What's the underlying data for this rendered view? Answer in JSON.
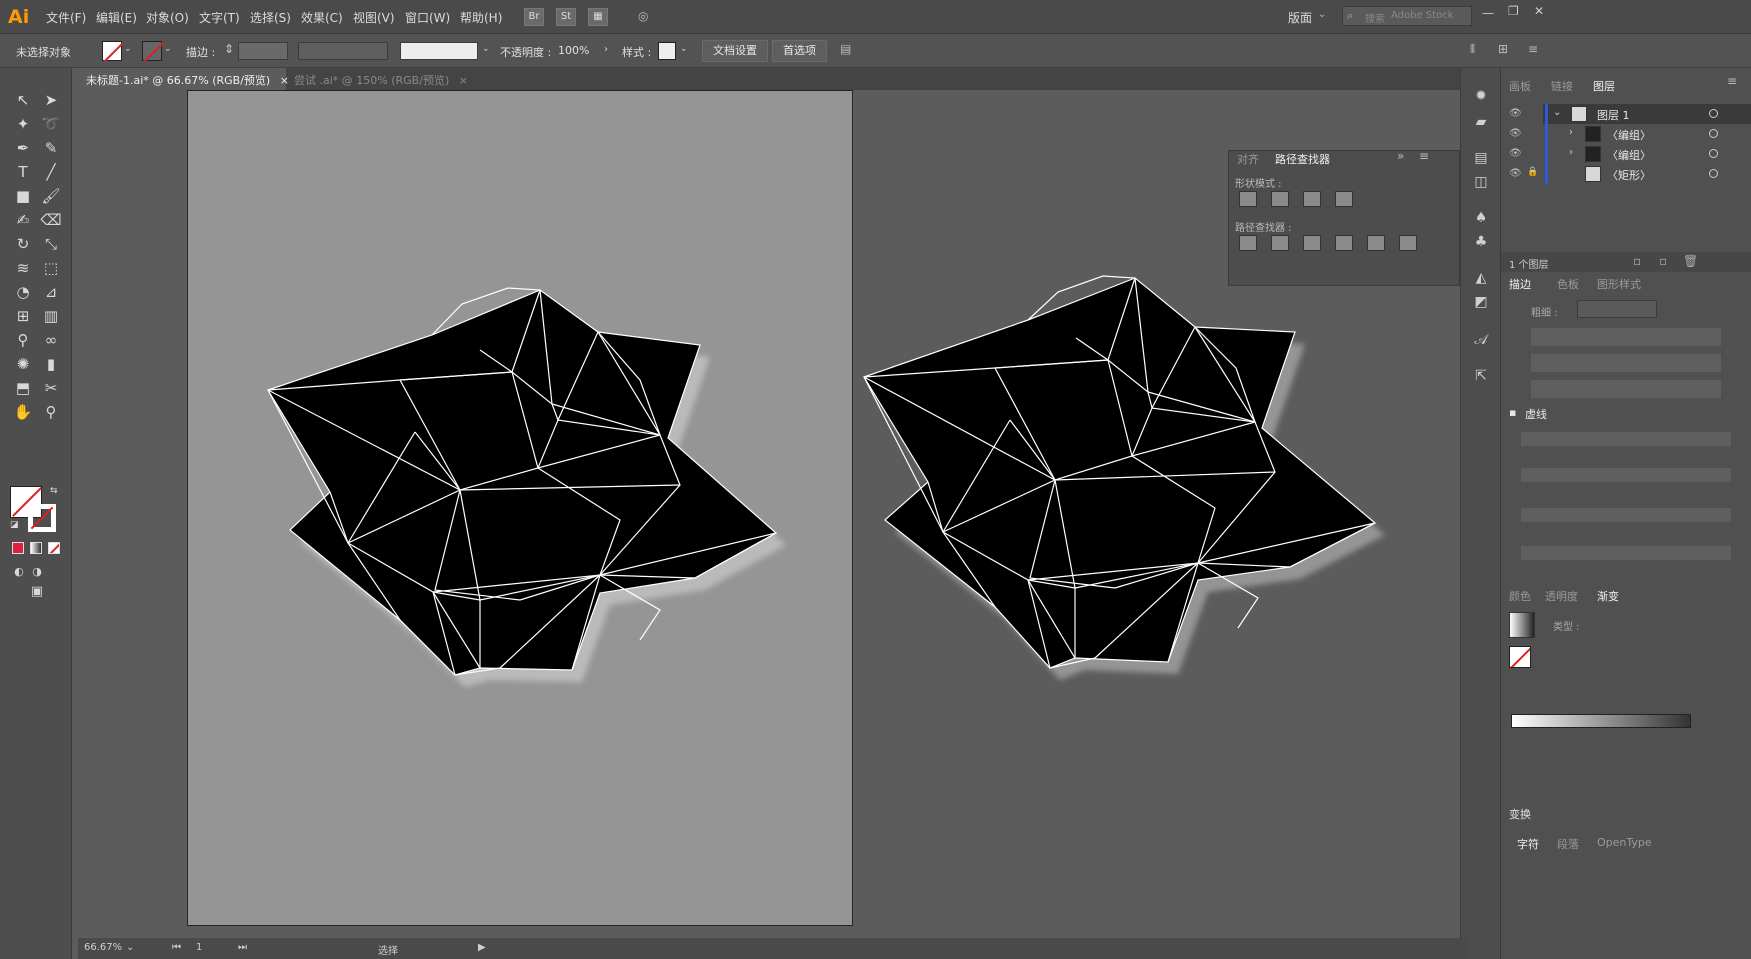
{
  "app": {
    "logo": "Ai"
  },
  "menubar": {
    "items": [
      "文件(F)",
      "编辑(E)",
      "对象(O)",
      "文字(T)",
      "选择(S)",
      "效果(C)",
      "视图(V)",
      "窗口(W)",
      "帮助(H)"
    ],
    "bridge": "Br",
    "stock": "St",
    "workspace": "版面",
    "search_placeholder": "Adobe Stock",
    "search_prefix": "搜索"
  },
  "control": {
    "selection": "未选择对象",
    "stroke_label": "描边 :",
    "opacity_label": "不透明度 :",
    "opacity_value": "100%",
    "style_label": "样式 :",
    "doc_setup": "文档设置",
    "preferences": "首选项"
  },
  "tabs": [
    {
      "label": "未标题-1.ai* @ 66.67% (RGB/预览)",
      "close": "×"
    },
    {
      "label": "尝试 .ai* @ 150% (RGB/预览)",
      "close": "×"
    }
  ],
  "status": {
    "zoom": "66.67%",
    "artboard": "1",
    "tool": "选择"
  },
  "pathfinder": {
    "tab_align": "对齐",
    "tab_pathfinder": "路径查找器",
    "shape_modes": "形状模式 :",
    "pathfinders": "路径查找器 :"
  },
  "panels": {
    "tab_artboards": "画板",
    "tab_links": "链接",
    "tab_layers": "图层",
    "layers": [
      {
        "name": "图层 1"
      },
      {
        "name": "〈编组〉"
      },
      {
        "name": "〈编组〉"
      },
      {
        "name": "〈矩形〉"
      }
    ],
    "layer_count": "1 个图层",
    "stroke_tab": "描边",
    "swatches_tab": "色板",
    "graphic_styles_tab": "图形样式",
    "weight_label": "粗细 :",
    "dashed_label": "虚线",
    "color_tab": "颜色",
    "transparency_tab": "透明度",
    "gradient_tab": "渐变",
    "type_label": "类型 :",
    "transform_tab": "变换",
    "character_tab": "字符",
    "paragraph_tab": "段落",
    "opentype_tab": "OpenType"
  },
  "colors": {
    "fill": "#ffffff",
    "none_slash": "#e02020",
    "art": "#000000",
    "edges": "#ffffff",
    "accent_blue": "#2d5bd8"
  }
}
